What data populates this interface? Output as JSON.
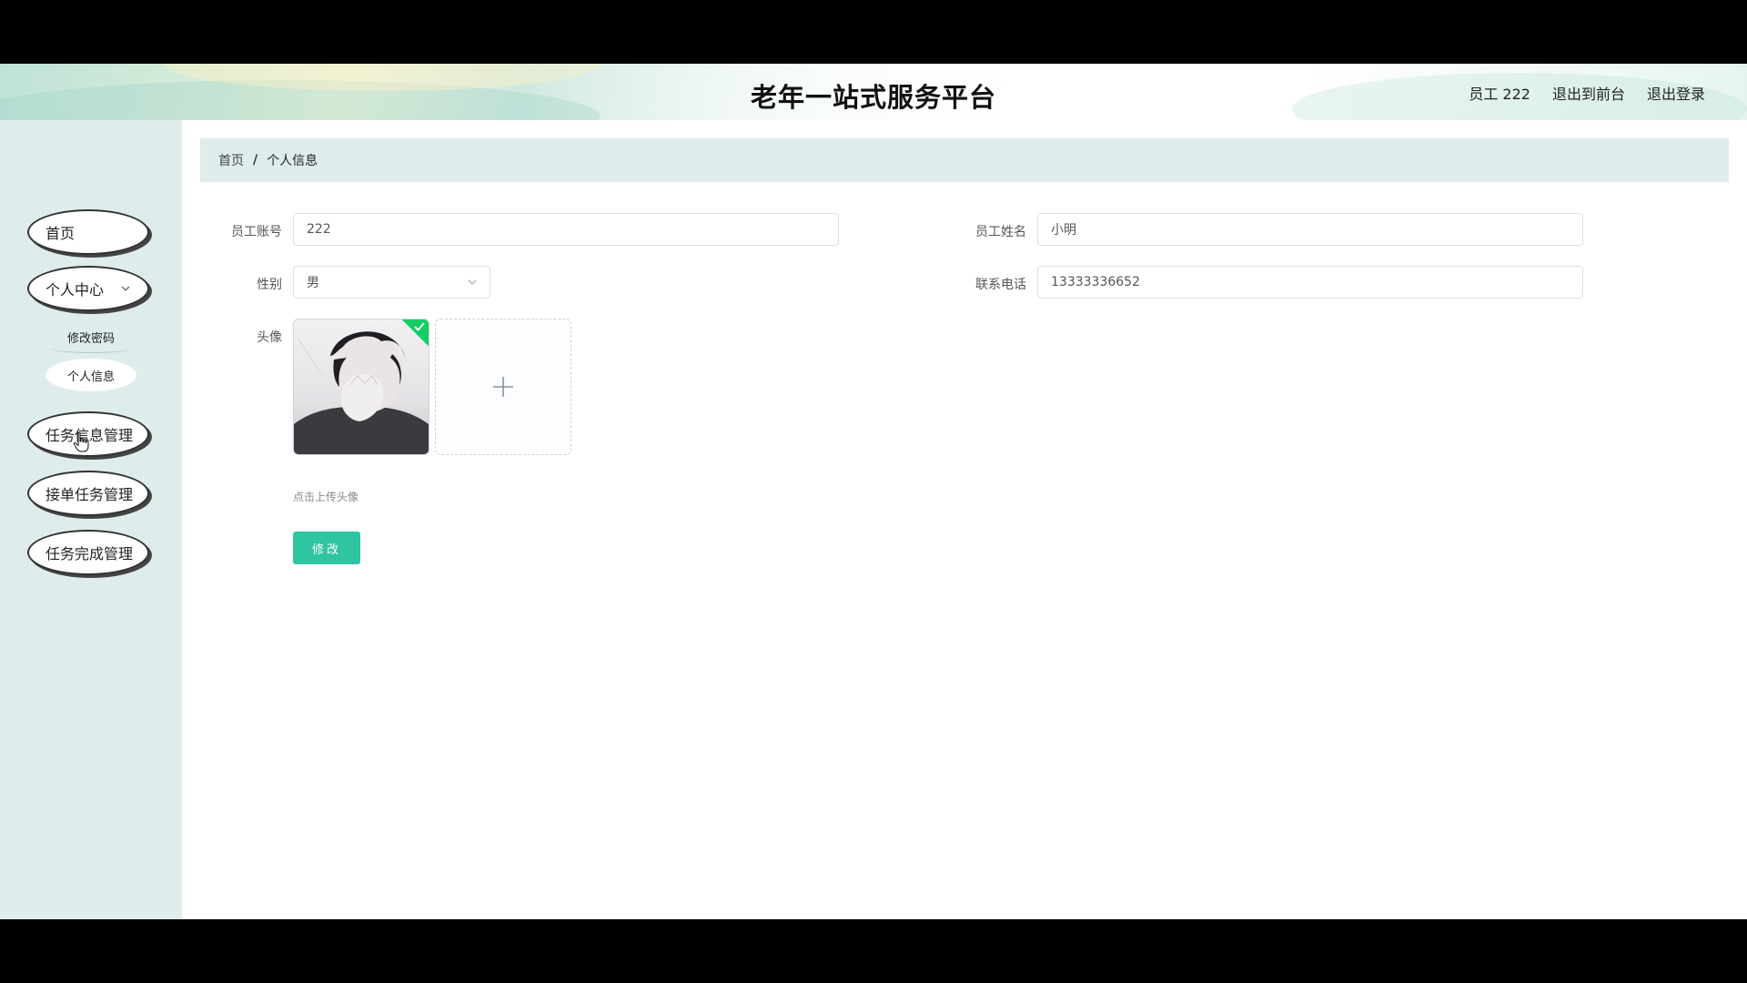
{
  "header": {
    "title": "老年一站式服务平台",
    "user_label": "员工 222",
    "to_front_label": "退出到前台",
    "logout_label": "退出登录"
  },
  "sidebar": {
    "home": "首页",
    "personal_center": "个人中心",
    "change_password": "修改密码",
    "personal_info": "个人信息",
    "task_info_mgmt": "任务信息管理",
    "accept_task_mgmt": "接单任务管理",
    "task_complete_mgmt": "任务完成管理"
  },
  "breadcrumb": {
    "home": "首页",
    "separator": "/",
    "current": "个人信息"
  },
  "form": {
    "account_label": "员工账号",
    "account_value": "222",
    "name_label": "员工姓名",
    "name_value": "小明",
    "gender_label": "性别",
    "gender_value": "男",
    "phone_label": "联系电话",
    "phone_value": "13333336652",
    "avatar_label": "头像",
    "upload_hint": "点击上传头像",
    "submit_label": "修改"
  },
  "colors": {
    "sidebar_bg": "#deedec",
    "accent": "#2fc4a2"
  }
}
